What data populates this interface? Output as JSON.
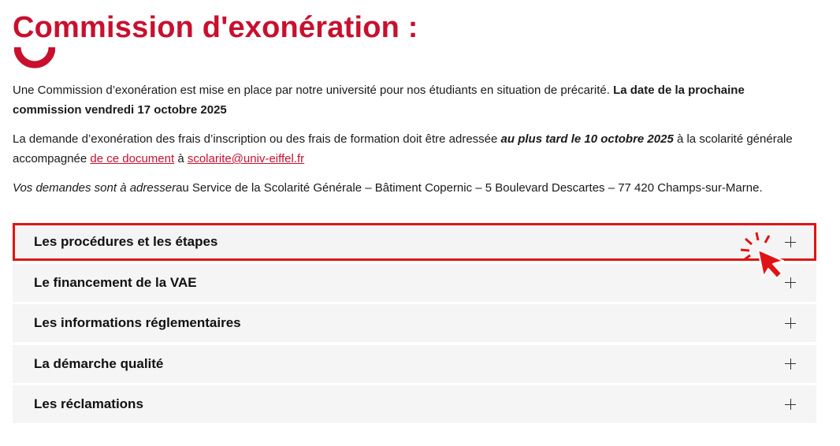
{
  "page": {
    "title": "Commission d'exonération :"
  },
  "intro": {
    "p1_text": "Une Commission d’exonération est mise en place par notre université pour nos étudiants en situation de précarité. ",
    "p1_bold": "La date de la prochaine commission vendredi 17 octobre 2025",
    "p2_text1": "La demande d’exonération des frais d’inscription ou des frais de formation doit être adressée ",
    "p2_bold": "au plus tard le 10 octobre 2025",
    "p2_text2": " à la scolarité générale accompagnée ",
    "p2_link1": "de ce document",
    "p2_text3": " à ",
    "p2_link2": "scolarite@univ-eiffel.fr",
    "p3_italic": "Vos demandes sont à adresser",
    "p3_text": "au Service de la Scolarité Générale – Bâtiment Copernic – 5 Boulevard Descartes – 77 420 Champs-sur-Marne",
    "p3_end": "."
  },
  "accordion": {
    "items": [
      {
        "label": "Les procédures et les étapes"
      },
      {
        "label": "Le financement de la VAE"
      },
      {
        "label": "Les informations réglementaires"
      },
      {
        "label": "La démarche qualité"
      },
      {
        "label": "Les réclamations"
      }
    ]
  },
  "colors": {
    "accent": "#c8102e",
    "highlight": "#e01414",
    "accordion_bg": "#f5f5f5"
  },
  "icons": {
    "expand": "plus-icon",
    "pointer": "hand-pointer-icon"
  }
}
